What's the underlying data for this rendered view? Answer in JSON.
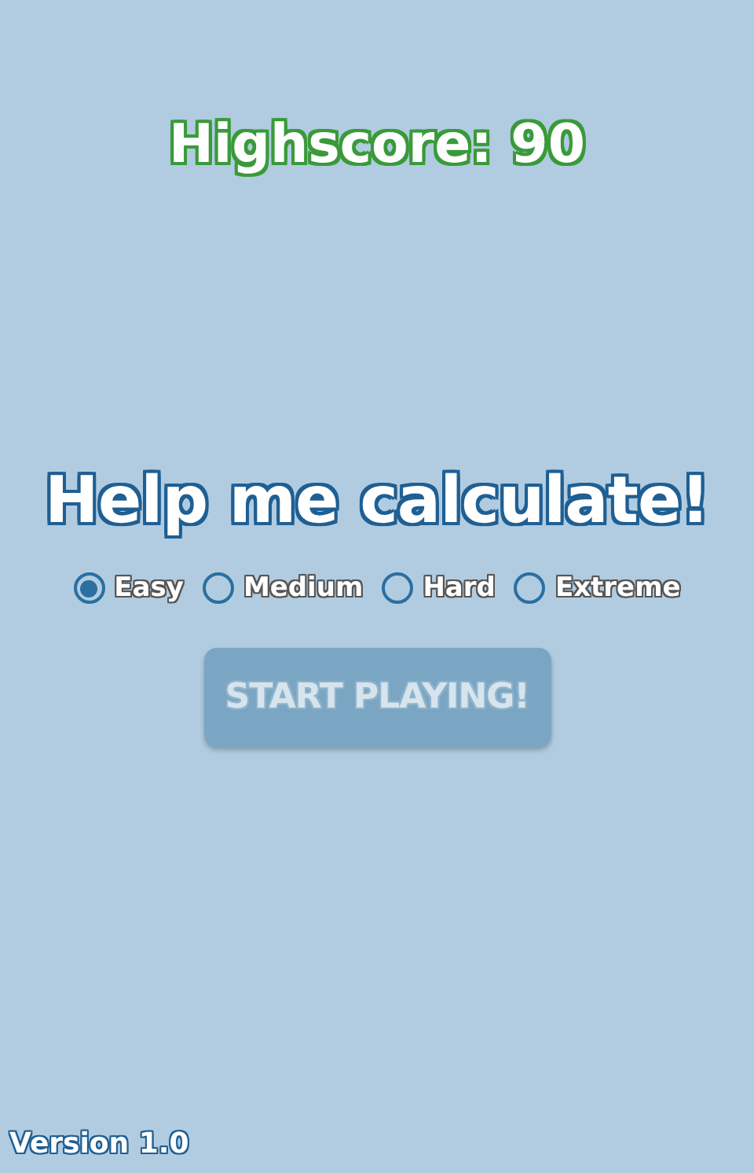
{
  "highscore": "Highscore: 90",
  "title": "Help me calculate!",
  "difficulties": [
    {
      "label": "Easy",
      "selected": true
    },
    {
      "label": "Medium",
      "selected": false
    },
    {
      "label": "Hard",
      "selected": false
    },
    {
      "label": "Extreme",
      "selected": false
    }
  ],
  "start_button": {
    "label": "START PLAYING!",
    "disabled": true
  },
  "version": "Version 1.0"
}
